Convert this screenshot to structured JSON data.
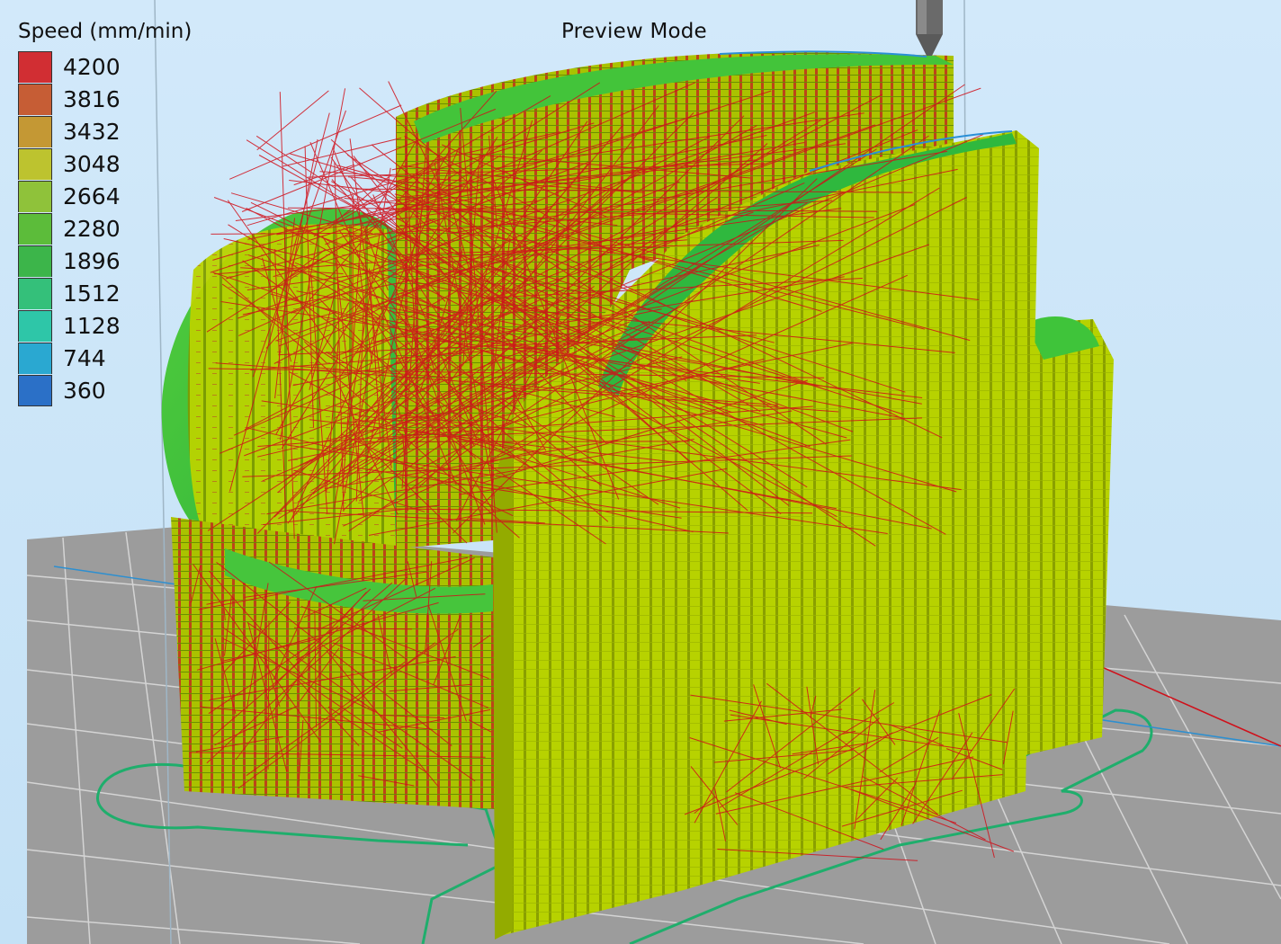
{
  "view": {
    "title": "Preview Mode"
  },
  "legend": {
    "title": "Speed (mm/min)",
    "entries": [
      {
        "label": "4200",
        "color": "#d12e33"
      },
      {
        "label": "3816",
        "color": "#c65d35"
      },
      {
        "label": "3432",
        "color": "#c49834"
      },
      {
        "label": "3048",
        "color": "#bdc32f"
      },
      {
        "label": "2664",
        "color": "#8fc23a"
      },
      {
        "label": "2280",
        "color": "#5cbc3a"
      },
      {
        "label": "1896",
        "color": "#3cb54a"
      },
      {
        "label": "1512",
        "color": "#34c07a"
      },
      {
        "label": "1128",
        "color": "#2ec6a8"
      },
      {
        "label": "744",
        "color": "#2aa8d1"
      },
      {
        "label": "360",
        "color": "#2b70c7"
      }
    ]
  },
  "colors": {
    "background": "#cfe7f8",
    "bed": "#9a9a9a",
    "bed_grid": "#cfcfcf",
    "travel": "#d0101a",
    "infill": "#b5d000",
    "perimeter": "#3fc43a",
    "outline": "#19a86a",
    "nozzle": "#555555"
  },
  "icons": {
    "nozzle": "nozzle-icon"
  }
}
